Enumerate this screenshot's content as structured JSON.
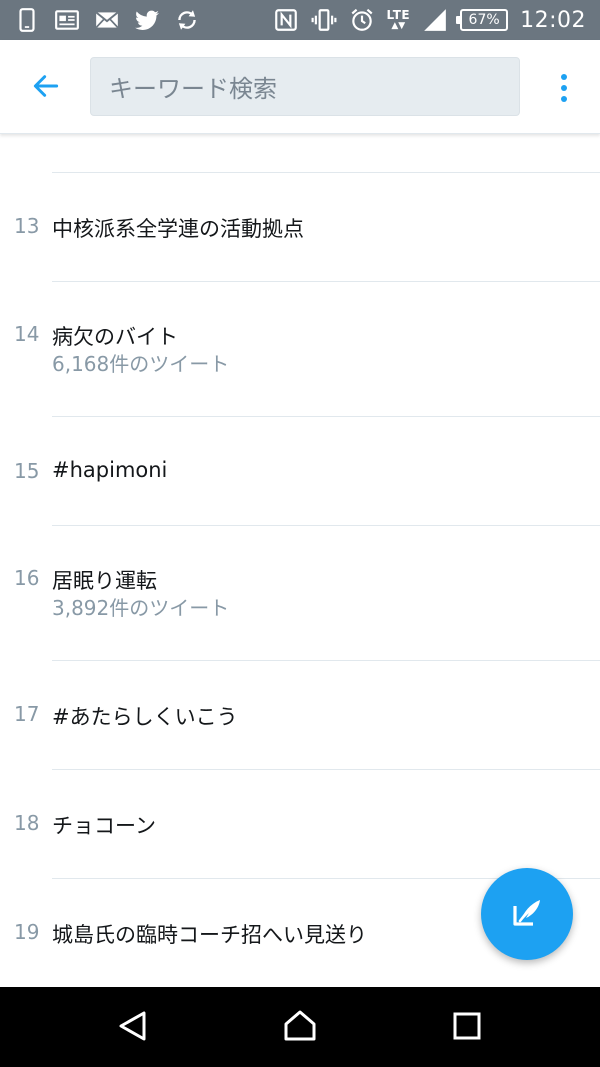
{
  "status_bar": {
    "left_icons": [
      "phone-icon",
      "news-icon",
      "mail-icon",
      "twitter-icon",
      "sync-icon"
    ],
    "right_icons": [
      "nfc-icon",
      "vibrate-icon",
      "alarm-icon",
      "lte-icon",
      "signal-icon",
      "battery-icon"
    ],
    "network_label": "LTE",
    "battery_label": "67%",
    "time": "12:02"
  },
  "app_bar": {
    "back_icon": "arrow-left-icon",
    "search_placeholder": "キーワード検索",
    "overflow_icon": "more-vertical-icon"
  },
  "trends": [
    {
      "rank": "13",
      "name": "中核派系全学連の活動拠点",
      "tweet_count": ""
    },
    {
      "rank": "14",
      "name": "病欠のバイト",
      "tweet_count": "6,168件のツイート"
    },
    {
      "rank": "15",
      "name": "#hapimoni",
      "tweet_count": ""
    },
    {
      "rank": "16",
      "name": "居眠り運転",
      "tweet_count": "3,892件のツイート"
    },
    {
      "rank": "17",
      "name": "#あたらしくいこう",
      "tweet_count": ""
    },
    {
      "rank": "18",
      "name": "チョコーン",
      "tweet_count": ""
    },
    {
      "rank": "19",
      "name": "城島氏の臨時コーチ招へい見送り",
      "tweet_count": ""
    }
  ],
  "fab": {
    "icon": "compose-tweet-icon"
  },
  "nav_bar": {
    "icons": [
      "back-triangle-icon",
      "home-icon",
      "recents-icon"
    ]
  },
  "colors": {
    "accent": "#1da1f2",
    "status_bar_bg": "#6b7680",
    "search_bg": "#e6ecf0",
    "primary_text": "#14171a",
    "secondary_text": "#8899a6",
    "divider": "#e1e8ed",
    "nav_bar_bg": "#000000"
  }
}
